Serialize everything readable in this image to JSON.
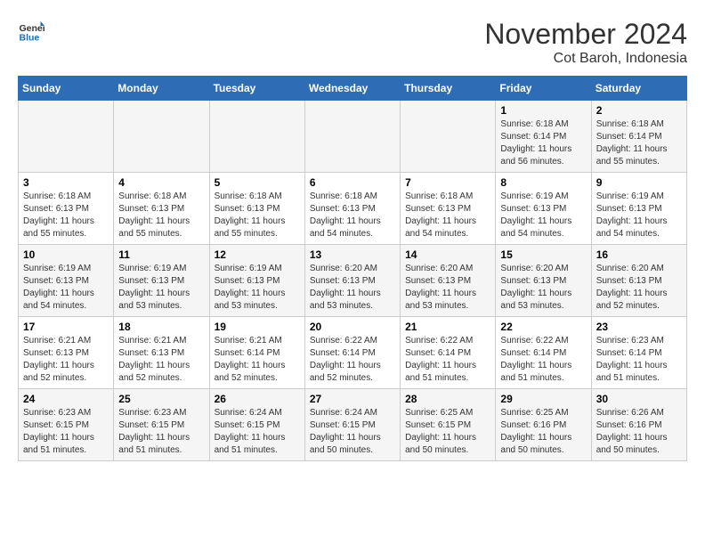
{
  "header": {
    "logo": {
      "line1": "General",
      "line2": "Blue"
    },
    "title": "November 2024",
    "subtitle": "Cot Baroh, Indonesia"
  },
  "weekdays": [
    "Sunday",
    "Monday",
    "Tuesday",
    "Wednesday",
    "Thursday",
    "Friday",
    "Saturday"
  ],
  "weeks": [
    [
      {
        "day": "",
        "info": ""
      },
      {
        "day": "",
        "info": ""
      },
      {
        "day": "",
        "info": ""
      },
      {
        "day": "",
        "info": ""
      },
      {
        "day": "",
        "info": ""
      },
      {
        "day": "1",
        "info": "Sunrise: 6:18 AM\nSunset: 6:14 PM\nDaylight: 11 hours and 56 minutes."
      },
      {
        "day": "2",
        "info": "Sunrise: 6:18 AM\nSunset: 6:14 PM\nDaylight: 11 hours and 55 minutes."
      }
    ],
    [
      {
        "day": "3",
        "info": "Sunrise: 6:18 AM\nSunset: 6:13 PM\nDaylight: 11 hours and 55 minutes."
      },
      {
        "day": "4",
        "info": "Sunrise: 6:18 AM\nSunset: 6:13 PM\nDaylight: 11 hours and 55 minutes."
      },
      {
        "day": "5",
        "info": "Sunrise: 6:18 AM\nSunset: 6:13 PM\nDaylight: 11 hours and 55 minutes."
      },
      {
        "day": "6",
        "info": "Sunrise: 6:18 AM\nSunset: 6:13 PM\nDaylight: 11 hours and 54 minutes."
      },
      {
        "day": "7",
        "info": "Sunrise: 6:18 AM\nSunset: 6:13 PM\nDaylight: 11 hours and 54 minutes."
      },
      {
        "day": "8",
        "info": "Sunrise: 6:19 AM\nSunset: 6:13 PM\nDaylight: 11 hours and 54 minutes."
      },
      {
        "day": "9",
        "info": "Sunrise: 6:19 AM\nSunset: 6:13 PM\nDaylight: 11 hours and 54 minutes."
      }
    ],
    [
      {
        "day": "10",
        "info": "Sunrise: 6:19 AM\nSunset: 6:13 PM\nDaylight: 11 hours and 54 minutes."
      },
      {
        "day": "11",
        "info": "Sunrise: 6:19 AM\nSunset: 6:13 PM\nDaylight: 11 hours and 53 minutes."
      },
      {
        "day": "12",
        "info": "Sunrise: 6:19 AM\nSunset: 6:13 PM\nDaylight: 11 hours and 53 minutes."
      },
      {
        "day": "13",
        "info": "Sunrise: 6:20 AM\nSunset: 6:13 PM\nDaylight: 11 hours and 53 minutes."
      },
      {
        "day": "14",
        "info": "Sunrise: 6:20 AM\nSunset: 6:13 PM\nDaylight: 11 hours and 53 minutes."
      },
      {
        "day": "15",
        "info": "Sunrise: 6:20 AM\nSunset: 6:13 PM\nDaylight: 11 hours and 53 minutes."
      },
      {
        "day": "16",
        "info": "Sunrise: 6:20 AM\nSunset: 6:13 PM\nDaylight: 11 hours and 52 minutes."
      }
    ],
    [
      {
        "day": "17",
        "info": "Sunrise: 6:21 AM\nSunset: 6:13 PM\nDaylight: 11 hours and 52 minutes."
      },
      {
        "day": "18",
        "info": "Sunrise: 6:21 AM\nSunset: 6:13 PM\nDaylight: 11 hours and 52 minutes."
      },
      {
        "day": "19",
        "info": "Sunrise: 6:21 AM\nSunset: 6:14 PM\nDaylight: 11 hours and 52 minutes."
      },
      {
        "day": "20",
        "info": "Sunrise: 6:22 AM\nSunset: 6:14 PM\nDaylight: 11 hours and 52 minutes."
      },
      {
        "day": "21",
        "info": "Sunrise: 6:22 AM\nSunset: 6:14 PM\nDaylight: 11 hours and 51 minutes."
      },
      {
        "day": "22",
        "info": "Sunrise: 6:22 AM\nSunset: 6:14 PM\nDaylight: 11 hours and 51 minutes."
      },
      {
        "day": "23",
        "info": "Sunrise: 6:23 AM\nSunset: 6:14 PM\nDaylight: 11 hours and 51 minutes."
      }
    ],
    [
      {
        "day": "24",
        "info": "Sunrise: 6:23 AM\nSunset: 6:15 PM\nDaylight: 11 hours and 51 minutes."
      },
      {
        "day": "25",
        "info": "Sunrise: 6:23 AM\nSunset: 6:15 PM\nDaylight: 11 hours and 51 minutes."
      },
      {
        "day": "26",
        "info": "Sunrise: 6:24 AM\nSunset: 6:15 PM\nDaylight: 11 hours and 51 minutes."
      },
      {
        "day": "27",
        "info": "Sunrise: 6:24 AM\nSunset: 6:15 PM\nDaylight: 11 hours and 50 minutes."
      },
      {
        "day": "28",
        "info": "Sunrise: 6:25 AM\nSunset: 6:15 PM\nDaylight: 11 hours and 50 minutes."
      },
      {
        "day": "29",
        "info": "Sunrise: 6:25 AM\nSunset: 6:16 PM\nDaylight: 11 hours and 50 minutes."
      },
      {
        "day": "30",
        "info": "Sunrise: 6:26 AM\nSunset: 6:16 PM\nDaylight: 11 hours and 50 minutes."
      }
    ]
  ]
}
